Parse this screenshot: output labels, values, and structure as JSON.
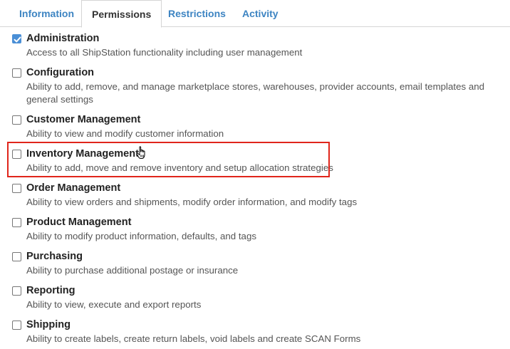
{
  "tabs": [
    {
      "label": "Information"
    },
    {
      "label": "Permissions"
    },
    {
      "label": "Restrictions"
    },
    {
      "label": "Activity"
    }
  ],
  "active_tab": "Permissions",
  "permissions": [
    {
      "title": "Administration",
      "description": "Access to all ShipStation functionality including user management",
      "checked": true
    },
    {
      "title": "Configuration",
      "description": "Ability to add, remove, and manage marketplace stores, warehouses, provider accounts, email templates and general settings",
      "checked": false
    },
    {
      "title": "Customer Management",
      "description": "Ability to view and modify customer information",
      "checked": false
    },
    {
      "title": "Inventory Management",
      "description": "Ability to add, move and remove inventory and setup allocation strategies",
      "checked": false
    },
    {
      "title": "Order Management",
      "description": "Ability to view orders and shipments, modify order information, and modify tags",
      "checked": false
    },
    {
      "title": "Product Management",
      "description": "Ability to modify product information, defaults, and tags",
      "checked": false
    },
    {
      "title": "Purchasing",
      "description": "Ability to purchase additional postage or insurance",
      "checked": false
    },
    {
      "title": "Reporting",
      "description": "Ability to view, execute and export reports",
      "checked": false
    },
    {
      "title": "Shipping",
      "description": "Ability to create labels, create return labels, void labels and create SCAN Forms",
      "checked": false
    }
  ],
  "colors": {
    "accent": "#3d84c2",
    "checkbox_checked": "#4a8fd6",
    "highlight": "#e0251b"
  }
}
